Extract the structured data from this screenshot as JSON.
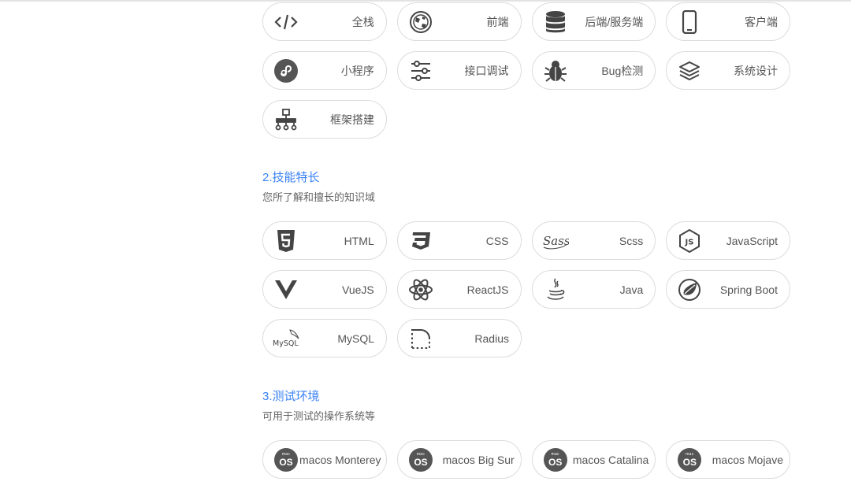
{
  "section1": {
    "items": [
      {
        "label": "全栈",
        "icon": "code-icon"
      },
      {
        "label": "前端",
        "icon": "globe-icon"
      },
      {
        "label": "后端/服务端",
        "icon": "database-icon"
      },
      {
        "label": "客户端",
        "icon": "mobile-icon"
      },
      {
        "label": "小程序",
        "icon": "miniprogram-icon"
      },
      {
        "label": "接口调试",
        "icon": "sliders-icon"
      },
      {
        "label": "Bug检测",
        "icon": "bug-icon"
      },
      {
        "label": "系统设计",
        "icon": "layers-icon"
      },
      {
        "label": "框架搭建",
        "icon": "hierarchy-icon"
      }
    ]
  },
  "section2": {
    "title": "2.技能特长",
    "subtitle": "您所了解和擅长的知识域",
    "items": [
      {
        "label": "HTML",
        "icon": "html5-icon"
      },
      {
        "label": "CSS",
        "icon": "css3-icon"
      },
      {
        "label": "Scss",
        "icon": "sass-icon",
        "icon_text": "Sass"
      },
      {
        "label": "JavaScript",
        "icon": "js-icon",
        "icon_text": "JS"
      },
      {
        "label": "VueJS",
        "icon": "vue-icon"
      },
      {
        "label": "ReactJS",
        "icon": "react-icon"
      },
      {
        "label": "Java",
        "icon": "java-icon"
      },
      {
        "label": "Spring Boot",
        "icon": "spring-icon"
      },
      {
        "label": "MySQL",
        "icon": "mysql-icon",
        "icon_text": "MySQL"
      },
      {
        "label": "Radius",
        "icon": "radius-icon"
      }
    ]
  },
  "section3": {
    "title": "3.测试环境",
    "subtitle": "可用于测试的操作系统等",
    "badge_small": "mac",
    "badge_big": "OS",
    "items": [
      {
        "label": "macos Monterey",
        "icon": "macos-icon"
      },
      {
        "label": "macos Big Sur",
        "icon": "macos-icon"
      },
      {
        "label": "macos Catalina",
        "icon": "macos-icon"
      },
      {
        "label": "macos Mojave",
        "icon": "macos-icon"
      }
    ]
  },
  "colors": {
    "accent": "#3b82f6",
    "icon": "#444444",
    "border": "#dcdcdc"
  }
}
